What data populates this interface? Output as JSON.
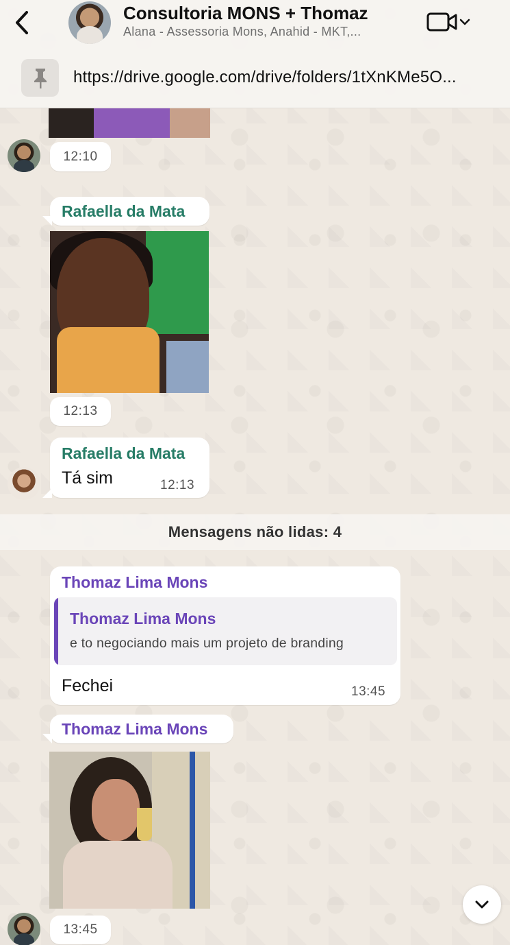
{
  "header": {
    "title": "Consultoria MONS + Thomaz",
    "subtitle": "Alana - Assessoria Mons, Anahid - MKT,...",
    "pinned_text": "https://drive.google.com/drive/folders/1tXnKMe5O..."
  },
  "messages": {
    "m1": {
      "time": "12:10"
    },
    "m2": {
      "sender": "Rafaella da Mata",
      "time": "12:13"
    },
    "m3": {
      "sender": "Rafaella da Mata",
      "text": "Tá sim",
      "time": "12:13"
    },
    "unread": "Mensagens não lidas: 4",
    "m4": {
      "sender": "Thomaz Lima Mons",
      "quoted_sender": "Thomaz Lima Mons",
      "quoted_text": "e to negociando mais um projeto de branding",
      "text": "Fechei",
      "time": "13:45"
    },
    "m5": {
      "sender": "Thomaz Lima Mons",
      "time": "13:45"
    }
  },
  "colors": {
    "green_sender": "#267c66",
    "purple_sender": "#6a45b8",
    "chat_background": "#efeae2"
  },
  "icons": [
    "chevron-left-icon",
    "video-camera-icon",
    "chevron-down-icon",
    "pin-icon",
    "scroll-down-icon"
  ]
}
